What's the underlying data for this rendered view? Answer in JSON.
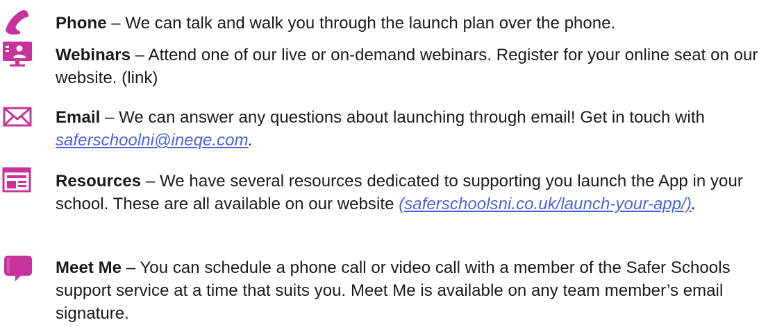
{
  "colors": {
    "accent": "#c8329b",
    "text": "#1a1a1a",
    "link": "#4a63d8"
  },
  "items": [
    {
      "icon": "phone-icon",
      "title": "Phone",
      "description": " – We can talk and walk you through the launch plan over the phone."
    },
    {
      "icon": "webinar-icon",
      "title": "Webinars",
      "description": " – Attend one of our live or on-demand webinars. Register for your online seat on our website. (link)"
    },
    {
      "icon": "email-icon",
      "title": "Email",
      "description": " – We can answer any questions about launching through email! Get in touch with ",
      "link": "saferschoolni@ineqe.com",
      "after": "."
    },
    {
      "icon": "resources-icon",
      "title": "Resources",
      "description": " – We have several resources dedicated to supporting you launch the App in your school. These are all available on our website ",
      "link": "(saferschoolsni.co.uk/launch-your-app/)",
      "after": "."
    },
    {
      "icon": "chat-icon",
      "title": "Meet Me",
      "description": " – You can schedule a phone call or video call with a member of the Safer Schools support service at a time that suits you. Meet Me is available on any team member’s email signature."
    }
  ]
}
